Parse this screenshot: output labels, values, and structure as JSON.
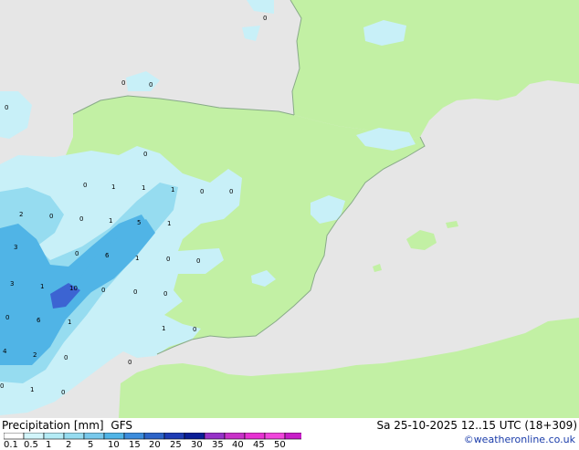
{
  "map": {
    "colors": {
      "sea": "#e6e6e6",
      "land": "#c2f0a4",
      "coast": "#88aa88",
      "precip_light": "#c8f0f8",
      "precip_mid": "#96dcf0",
      "precip_heavy": "#50b4e6",
      "precip_dark": "#3c64d2"
    },
    "values": [
      "0",
      "0",
      "0",
      "0",
      "0",
      "0",
      "0",
      "0",
      "1",
      "1",
      "1",
      "0",
      "0",
      "2",
      "0",
      "0",
      "1",
      "5",
      "1",
      "3",
      "0",
      "6",
      "1",
      "0",
      "0",
      "3",
      "1",
      "10",
      "0",
      "0",
      "0",
      "6",
      "1",
      "1",
      "0",
      "4",
      "2",
      "0",
      "1",
      "0",
      "0"
    ]
  },
  "footer": {
    "title": "Precipitation [mm]",
    "model": "GFS",
    "datetime": "Sa 25-10-2025 12..15 UTC (18+309)",
    "credit": "©weatheronline.co.uk",
    "scale_labels": [
      "0.1",
      "0.5",
      "1",
      "2",
      "5",
      "10",
      "15",
      "20",
      "25",
      "30",
      "35",
      "40",
      "45",
      "50"
    ],
    "scale_colors": [
      "#ffffff",
      "#d2f5fa",
      "#b4ebf5",
      "#96dcf0",
      "#78c8eb",
      "#50b4e6",
      "#3c8cdc",
      "#2d64c8",
      "#1e3cb4",
      "#0a1e96",
      "#9632c8",
      "#c832c8",
      "#e632d2",
      "#f046dc",
      "#c81ec8"
    ]
  }
}
